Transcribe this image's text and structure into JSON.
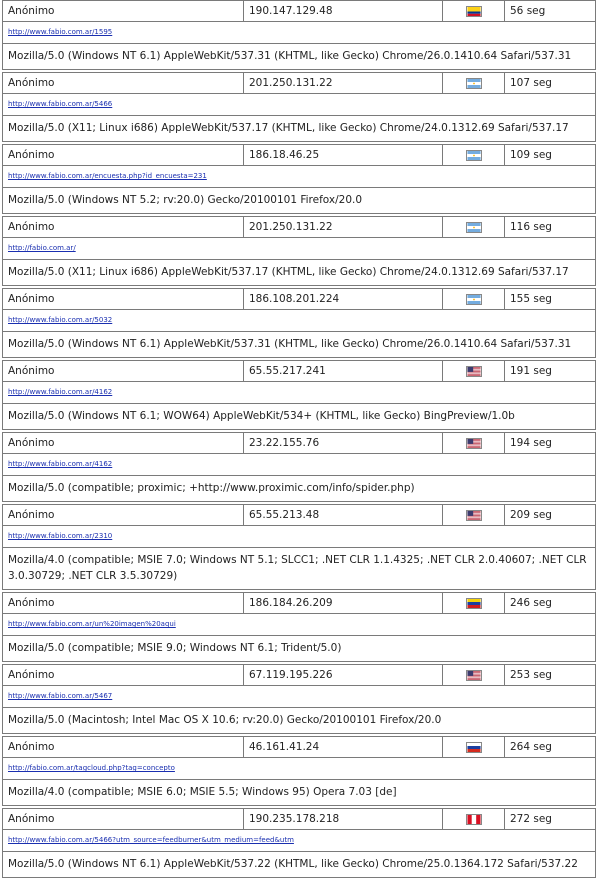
{
  "visitors": [
    {
      "user": "Anónimo",
      "ip": "190.147.129.48",
      "flag": "colombia-flag",
      "time": "56 seg",
      "url": "http://www.fabio.com.ar/1595",
      "ua": "Mozilla/5.0 (Windows NT 6.1) AppleWebKit/537.31 (KHTML, like Gecko) Chrome/26.0.1410.64 Safari/537.31"
    },
    {
      "user": "Anónimo",
      "ip": "201.250.131.22",
      "flag": "argentina-flag",
      "time": "107 seg",
      "url": "http://www.fabio.com.ar/5466",
      "ua": "Mozilla/5.0 (X11; Linux i686) AppleWebKit/537.17 (KHTML, like Gecko) Chrome/24.0.1312.69 Safari/537.17"
    },
    {
      "user": "Anónimo",
      "ip": "186.18.46.25",
      "flag": "argentina-flag",
      "time": "109 seg",
      "url": "http://www.fabio.com.ar/encuesta.php?id_encuesta=231",
      "ua": "Mozilla/5.0 (Windows NT 5.2; rv:20.0) Gecko/20100101 Firefox/20.0"
    },
    {
      "user": "Anónimo",
      "ip": "201.250.131.22",
      "flag": "argentina-flag",
      "time": "116 seg",
      "url": "http://fabio.com.ar/",
      "ua": "Mozilla/5.0 (X11; Linux i686) AppleWebKit/537.17 (KHTML, like Gecko) Chrome/24.0.1312.69 Safari/537.17"
    },
    {
      "user": "Anónimo",
      "ip": "186.108.201.224",
      "flag": "argentina-flag",
      "time": "155 seg",
      "url": "http://www.fabio.com.ar/5032",
      "ua": "Mozilla/5.0 (Windows NT 6.1) AppleWebKit/537.31 (KHTML, like Gecko) Chrome/26.0.1410.64 Safari/537.31"
    },
    {
      "user": "Anónimo",
      "ip": "65.55.217.241",
      "flag": "usa-flag",
      "time": "191 seg",
      "url": "http://www.fabio.com.ar/4162",
      "ua": "Mozilla/5.0 (Windows NT 6.1; WOW64) AppleWebKit/534+ (KHTML, like Gecko) BingPreview/1.0b"
    },
    {
      "user": "Anónimo",
      "ip": "23.22.155.76",
      "flag": "usa-flag",
      "time": "194 seg",
      "url": "http://www.fabio.com.ar/4162",
      "ua": "Mozilla/5.0 (compatible; proximic; +http://www.proximic.com/info/spider.php)"
    },
    {
      "user": "Anónimo",
      "ip": "65.55.213.48",
      "flag": "usa-flag",
      "time": "209 seg",
      "url": "http://www.fabio.com.ar/2310",
      "ua": "Mozilla/4.0 (compatible; MSIE 7.0; Windows NT 5.1; SLCC1; .NET CLR 1.1.4325; .NET CLR 2.0.40607; .NET CLR 3.0.30729; .NET CLR 3.5.30729)"
    },
    {
      "user": "Anónimo",
      "ip": "186.184.26.209",
      "flag": "venezuela-flag",
      "time": "246 seg",
      "url": "http://www.fabio.com.ar/un%20imagen%20aqui",
      "ua": "Mozilla/5.0 (compatible; MSIE 9.0; Windows NT 6.1; Trident/5.0)"
    },
    {
      "user": "Anónimo",
      "ip": "67.119.195.226",
      "flag": "usa-flag",
      "time": "253 seg",
      "url": "http://www.fabio.com.ar/5467",
      "ua": "Mozilla/5.0 (Macintosh; Intel Mac OS X 10.6; rv:20.0) Gecko/20100101 Firefox/20.0"
    },
    {
      "user": "Anónimo",
      "ip": "46.161.41.24",
      "flag": "russia-flag",
      "time": "264 seg",
      "url": "http://fabio.com.ar/tagcloud.php?tag=concepto",
      "ua": "Mozilla/4.0 (compatible; MSIE 6.0; MSIE 5.5; Windows 95) Opera 7.03 [de]"
    },
    {
      "user": "Anónimo",
      "ip": "190.235.178.218",
      "flag": "peru-flag",
      "time": "272 seg",
      "url": "http://www.fabio.com.ar/5466?utm_source=feedburner&utm_medium=feed&utm",
      "ua": "Mozilla/5.0 (Windows NT 6.1) AppleWebKit/537.22 (KHTML, like Gecko) Chrome/25.0.1364.172 Safari/537.22"
    }
  ],
  "flag_colors": {
    "colombia-flag": [
      "#fcd116",
      "#003893",
      "#ce1126"
    ],
    "venezuela-flag": [
      "#f4d20b",
      "#1b3fa0",
      "#d01c1f"
    ],
    "argentina-flag": [
      "#74acdf",
      "#ffffff",
      "#74acdf"
    ],
    "russia-flag": [
      "#ffffff",
      "#1b3fa0",
      "#d52b1e"
    ],
    "peru-flag": [
      "#d91023",
      "#ffffff",
      "#d91023"
    ],
    "usa-flag": [
      "#b22234",
      "#ffffff",
      "#3c3b6e"
    ]
  }
}
